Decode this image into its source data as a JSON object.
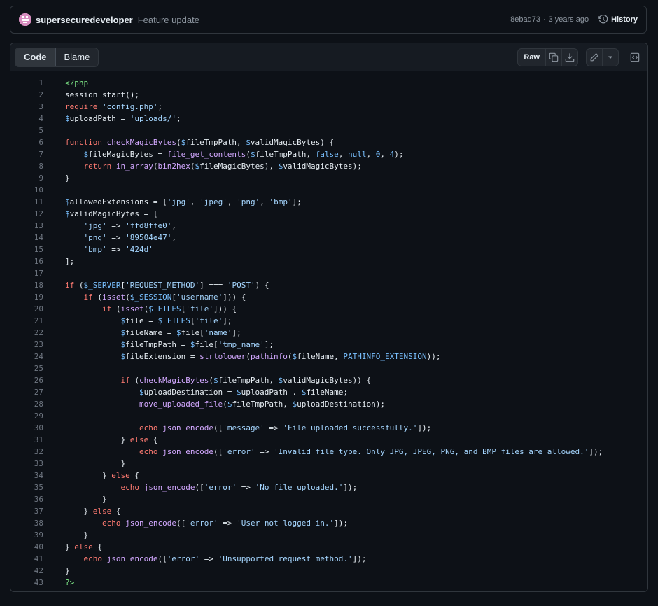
{
  "commit": {
    "author": "supersecuredeveloper",
    "message": "Feature update",
    "hash": "8ebad73",
    "separator": "·",
    "age": "3 years ago",
    "history_label": "History"
  },
  "file_header": {
    "tabs": [
      {
        "label": "Code",
        "active": true
      },
      {
        "label": "Blame",
        "active": false
      }
    ],
    "raw_label": "Raw"
  },
  "code_lines": [
    [
      [
        "t",
        "<?php"
      ]
    ],
    [
      [
        "p",
        "session_start();"
      ]
    ],
    [
      [
        "k",
        "require"
      ],
      [
        "p",
        " "
      ],
      [
        "s",
        "'config.php'"
      ],
      [
        "p",
        ";"
      ]
    ],
    [
      [
        "v",
        "$"
      ],
      [
        "p",
        "uploadPath = "
      ],
      [
        "s",
        "'uploads/'"
      ],
      [
        "p",
        ";"
      ]
    ],
    [],
    [
      [
        "k",
        "function"
      ],
      [
        "p",
        " "
      ],
      [
        "f",
        "checkMagicBytes"
      ],
      [
        "p",
        "("
      ],
      [
        "v",
        "$"
      ],
      [
        "p",
        "fileTmpPath, "
      ],
      [
        "v",
        "$"
      ],
      [
        "p",
        "validMagicBytes) {"
      ]
    ],
    [
      [
        "p",
        "    "
      ],
      [
        "v",
        "$"
      ],
      [
        "p",
        "fileMagicBytes = "
      ],
      [
        "f",
        "file_get_contents"
      ],
      [
        "p",
        "("
      ],
      [
        "v",
        "$"
      ],
      [
        "p",
        "fileTmpPath, "
      ],
      [
        "v",
        "false"
      ],
      [
        "p",
        ", "
      ],
      [
        "v",
        "null"
      ],
      [
        "p",
        ", "
      ],
      [
        "v",
        "0"
      ],
      [
        "p",
        ", "
      ],
      [
        "v",
        "4"
      ],
      [
        "p",
        ");"
      ]
    ],
    [
      [
        "p",
        "    "
      ],
      [
        "k",
        "return"
      ],
      [
        "p",
        " "
      ],
      [
        "f",
        "in_array"
      ],
      [
        "p",
        "("
      ],
      [
        "f",
        "bin2hex"
      ],
      [
        "p",
        "("
      ],
      [
        "v",
        "$"
      ],
      [
        "p",
        "fileMagicBytes), "
      ],
      [
        "v",
        "$"
      ],
      [
        "p",
        "validMagicBytes);"
      ]
    ],
    [
      [
        "p",
        "}"
      ]
    ],
    [],
    [
      [
        "v",
        "$"
      ],
      [
        "p",
        "allowedExtensions = ["
      ],
      [
        "s",
        "'jpg'"
      ],
      [
        "p",
        ", "
      ],
      [
        "s",
        "'jpeg'"
      ],
      [
        "p",
        ", "
      ],
      [
        "s",
        "'png'"
      ],
      [
        "p",
        ", "
      ],
      [
        "s",
        "'bmp'"
      ],
      [
        "p",
        "];"
      ]
    ],
    [
      [
        "v",
        "$"
      ],
      [
        "p",
        "validMagicBytes = ["
      ]
    ],
    [
      [
        "p",
        "    "
      ],
      [
        "s",
        "'jpg'"
      ],
      [
        "p",
        " => "
      ],
      [
        "s",
        "'ffd8ffe0'"
      ],
      [
        "p",
        ","
      ]
    ],
    [
      [
        "p",
        "    "
      ],
      [
        "s",
        "'png'"
      ],
      [
        "p",
        " => "
      ],
      [
        "s",
        "'89504e47'"
      ],
      [
        "p",
        ","
      ]
    ],
    [
      [
        "p",
        "    "
      ],
      [
        "s",
        "'bmp'"
      ],
      [
        "p",
        " => "
      ],
      [
        "s",
        "'424d'"
      ]
    ],
    [
      [
        "p",
        "];"
      ]
    ],
    [],
    [
      [
        "k",
        "if"
      ],
      [
        "p",
        " ("
      ],
      [
        "v",
        "$_SERVER"
      ],
      [
        "p",
        "["
      ],
      [
        "s",
        "'REQUEST_METHOD'"
      ],
      [
        "p",
        "] === "
      ],
      [
        "s",
        "'POST'"
      ],
      [
        "p",
        ") {"
      ]
    ],
    [
      [
        "p",
        "    "
      ],
      [
        "k",
        "if"
      ],
      [
        "p",
        " ("
      ],
      [
        "f",
        "isset"
      ],
      [
        "p",
        "("
      ],
      [
        "v",
        "$_SESSION"
      ],
      [
        "p",
        "["
      ],
      [
        "s",
        "'username'"
      ],
      [
        "p",
        "])) {"
      ]
    ],
    [
      [
        "p",
        "        "
      ],
      [
        "k",
        "if"
      ],
      [
        "p",
        " ("
      ],
      [
        "f",
        "isset"
      ],
      [
        "p",
        "("
      ],
      [
        "v",
        "$_FILES"
      ],
      [
        "p",
        "["
      ],
      [
        "s",
        "'file'"
      ],
      [
        "p",
        "])) {"
      ]
    ],
    [
      [
        "p",
        "            "
      ],
      [
        "v",
        "$"
      ],
      [
        "p",
        "file = "
      ],
      [
        "v",
        "$_FILES"
      ],
      [
        "p",
        "["
      ],
      [
        "s",
        "'file'"
      ],
      [
        "p",
        "];"
      ]
    ],
    [
      [
        "p",
        "            "
      ],
      [
        "v",
        "$"
      ],
      [
        "p",
        "fileName = "
      ],
      [
        "v",
        "$"
      ],
      [
        "p",
        "file["
      ],
      [
        "s",
        "'name'"
      ],
      [
        "p",
        "];"
      ]
    ],
    [
      [
        "p",
        "            "
      ],
      [
        "v",
        "$"
      ],
      [
        "p",
        "fileTmpPath = "
      ],
      [
        "v",
        "$"
      ],
      [
        "p",
        "file["
      ],
      [
        "s",
        "'tmp_name'"
      ],
      [
        "p",
        "];"
      ]
    ],
    [
      [
        "p",
        "            "
      ],
      [
        "v",
        "$"
      ],
      [
        "p",
        "fileExtension = "
      ],
      [
        "f",
        "strtolower"
      ],
      [
        "p",
        "("
      ],
      [
        "f",
        "pathinfo"
      ],
      [
        "p",
        "("
      ],
      [
        "v",
        "$"
      ],
      [
        "p",
        "fileName, "
      ],
      [
        "v",
        "PATHINFO_EXTENSION"
      ],
      [
        "p",
        "));"
      ]
    ],
    [],
    [
      [
        "p",
        "            "
      ],
      [
        "k",
        "if"
      ],
      [
        "p",
        " ("
      ],
      [
        "f",
        "checkMagicBytes"
      ],
      [
        "p",
        "("
      ],
      [
        "v",
        "$"
      ],
      [
        "p",
        "fileTmpPath, "
      ],
      [
        "v",
        "$"
      ],
      [
        "p",
        "validMagicBytes)) {"
      ]
    ],
    [
      [
        "p",
        "                "
      ],
      [
        "v",
        "$"
      ],
      [
        "p",
        "uploadDestination = "
      ],
      [
        "v",
        "$"
      ],
      [
        "p",
        "uploadPath . "
      ],
      [
        "v",
        "$"
      ],
      [
        "p",
        "fileName;"
      ]
    ],
    [
      [
        "p",
        "                "
      ],
      [
        "f",
        "move_uploaded_file"
      ],
      [
        "p",
        "("
      ],
      [
        "v",
        "$"
      ],
      [
        "p",
        "fileTmpPath, "
      ],
      [
        "v",
        "$"
      ],
      [
        "p",
        "uploadDestination);"
      ]
    ],
    [],
    [
      [
        "p",
        "                "
      ],
      [
        "k",
        "echo"
      ],
      [
        "p",
        " "
      ],
      [
        "f",
        "json_encode"
      ],
      [
        "p",
        "(["
      ],
      [
        "s",
        "'message'"
      ],
      [
        "p",
        " => "
      ],
      [
        "s",
        "'File uploaded successfully.'"
      ],
      [
        "p",
        "]);"
      ]
    ],
    [
      [
        "p",
        "            } "
      ],
      [
        "k",
        "else"
      ],
      [
        "p",
        " {"
      ]
    ],
    [
      [
        "p",
        "                "
      ],
      [
        "k",
        "echo"
      ],
      [
        "p",
        " "
      ],
      [
        "f",
        "json_encode"
      ],
      [
        "p",
        "(["
      ],
      [
        "s",
        "'error'"
      ],
      [
        "p",
        " => "
      ],
      [
        "s",
        "'Invalid file type. Only JPG, JPEG, PNG, and BMP files are allowed.'"
      ],
      [
        "p",
        "]);"
      ]
    ],
    [
      [
        "p",
        "            }"
      ]
    ],
    [
      [
        "p",
        "        } "
      ],
      [
        "k",
        "else"
      ],
      [
        "p",
        " {"
      ]
    ],
    [
      [
        "p",
        "            "
      ],
      [
        "k",
        "echo"
      ],
      [
        "p",
        " "
      ],
      [
        "f",
        "json_encode"
      ],
      [
        "p",
        "(["
      ],
      [
        "s",
        "'error'"
      ],
      [
        "p",
        " => "
      ],
      [
        "s",
        "'No file uploaded.'"
      ],
      [
        "p",
        "]);"
      ]
    ],
    [
      [
        "p",
        "        }"
      ]
    ],
    [
      [
        "p",
        "    } "
      ],
      [
        "k",
        "else"
      ],
      [
        "p",
        " {"
      ]
    ],
    [
      [
        "p",
        "        "
      ],
      [
        "k",
        "echo"
      ],
      [
        "p",
        " "
      ],
      [
        "f",
        "json_encode"
      ],
      [
        "p",
        "(["
      ],
      [
        "s",
        "'error'"
      ],
      [
        "p",
        " => "
      ],
      [
        "s",
        "'User not logged in.'"
      ],
      [
        "p",
        "]);"
      ]
    ],
    [
      [
        "p",
        "    }"
      ]
    ],
    [
      [
        "p",
        "} "
      ],
      [
        "k",
        "else"
      ],
      [
        "p",
        " {"
      ]
    ],
    [
      [
        "p",
        "    "
      ],
      [
        "k",
        "echo"
      ],
      [
        "p",
        " "
      ],
      [
        "f",
        "json_encode"
      ],
      [
        "p",
        "(["
      ],
      [
        "s",
        "'error'"
      ],
      [
        "p",
        " => "
      ],
      [
        "s",
        "'Unsupported request method.'"
      ],
      [
        "p",
        "]);"
      ]
    ],
    [
      [
        "p",
        "}"
      ]
    ],
    [
      [
        "t",
        "?>"
      ]
    ]
  ],
  "icons": {
    "avatar": "avatar-identicon",
    "history": "history-icon",
    "copy": "copy-icon",
    "download": "download-icon",
    "edit": "pencil-icon",
    "more": "triangle-down-icon",
    "symbols": "code-square-icon"
  },
  "colors": {
    "background": "#0d1117",
    "header": "#161b22",
    "border": "#30363d",
    "keyword": "#ff7b72",
    "string": "#a5d6ff",
    "variable": "#79c0ff",
    "function": "#d2a8ff",
    "tag": "#7ee787",
    "line_number": "#6e7681"
  }
}
